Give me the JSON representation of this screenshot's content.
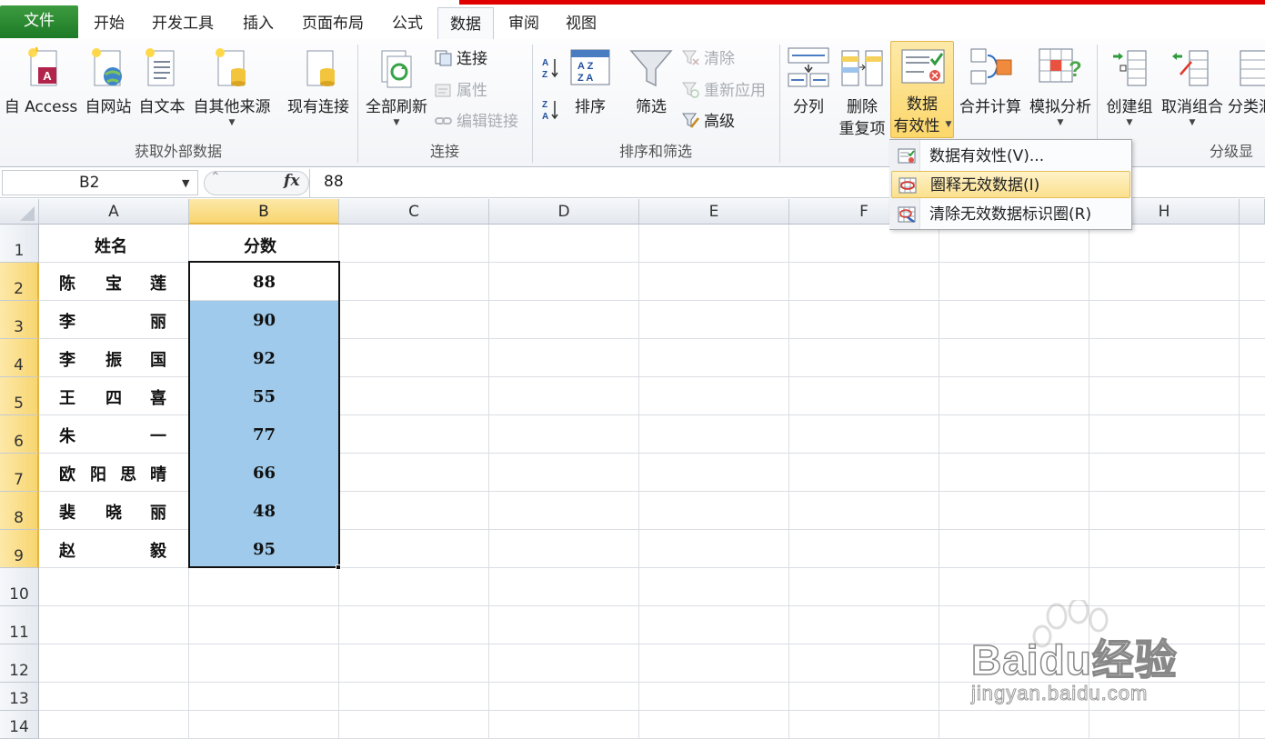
{
  "tabs": [
    {
      "label": "文件"
    },
    {
      "label": "开始"
    },
    {
      "label": "开发工具"
    },
    {
      "label": "插入"
    },
    {
      "label": "页面布局"
    },
    {
      "label": "公式"
    },
    {
      "label": "数据"
    },
    {
      "label": "审阅"
    },
    {
      "label": "视图"
    }
  ],
  "active_tab": "数据",
  "ribbon": {
    "groups": [
      {
        "label": "获取外部数据"
      },
      {
        "label": "连接"
      },
      {
        "label": "排序和筛选"
      },
      {
        "label": "分级显"
      }
    ],
    "external": {
      "access": "自 Access",
      "web": "自网站",
      "text": "自文本",
      "other": "自其他来源",
      "existing": "现有连接"
    },
    "connections": {
      "refresh_all": "全部刷新",
      "connections": "连接",
      "properties": "属性",
      "edit_links": "编辑链接"
    },
    "sort_filter": {
      "sort": "排序",
      "filter": "筛选",
      "clear": "清除",
      "reapply": "重新应用",
      "advanced": "高级"
    },
    "tools": {
      "text_to_columns": "分列",
      "remove_dup_1": "删除",
      "remove_dup_2": "重复项",
      "validation_1": "数据",
      "validation_2": "有效性",
      "consolidate": "合并计算",
      "what_if": "模拟分析"
    },
    "outline": {
      "group": "创建组",
      "ungroup": "取消组合",
      "subtotal": "分类汇"
    }
  },
  "validation_menu": {
    "items": [
      {
        "label": "数据有效性(V)..."
      },
      {
        "label": "圈释无效数据(I)"
      },
      {
        "label": "清除无效数据标识圈(R)"
      }
    ],
    "hovered_index": 1
  },
  "formula_bar": {
    "name_box": "B2",
    "fx": "fx",
    "value": "88"
  },
  "sheet": {
    "columns": [
      "A",
      "B",
      "C",
      "D",
      "E",
      "F",
      "G",
      "H"
    ],
    "rows": [
      "1",
      "2",
      "3",
      "4",
      "5",
      "6",
      "7",
      "8",
      "9",
      "10",
      "11",
      "12",
      "13",
      "14"
    ],
    "header": {
      "name": "姓名",
      "score": "分数"
    },
    "records": [
      {
        "name": [
          "陈",
          "宝",
          "莲"
        ],
        "score": "88"
      },
      {
        "name": [
          "李",
          "丽"
        ],
        "score": "90"
      },
      {
        "name": [
          "李",
          "振",
          "国"
        ],
        "score": "92"
      },
      {
        "name": [
          "王",
          "四",
          "喜"
        ],
        "score": "55"
      },
      {
        "name": [
          "朱",
          "一"
        ],
        "score": "77"
      },
      {
        "name": [
          "欧",
          "阳",
          "思",
          "晴"
        ],
        "score": "66"
      },
      {
        "name": [
          "裴",
          "晓",
          "丽"
        ],
        "score": "48"
      },
      {
        "name": [
          "赵",
          "毅"
        ],
        "score": "95"
      }
    ],
    "selection": "B2:B9"
  },
  "watermark": {
    "brand": "Baidu经验",
    "url": "jingyan.baidu.com"
  },
  "colors": {
    "file_tab": "#2e8b34",
    "selection_fill": "#9fcaeb",
    "header_highlight": "#f7d56f",
    "menu_hover": "#fbe08e"
  }
}
